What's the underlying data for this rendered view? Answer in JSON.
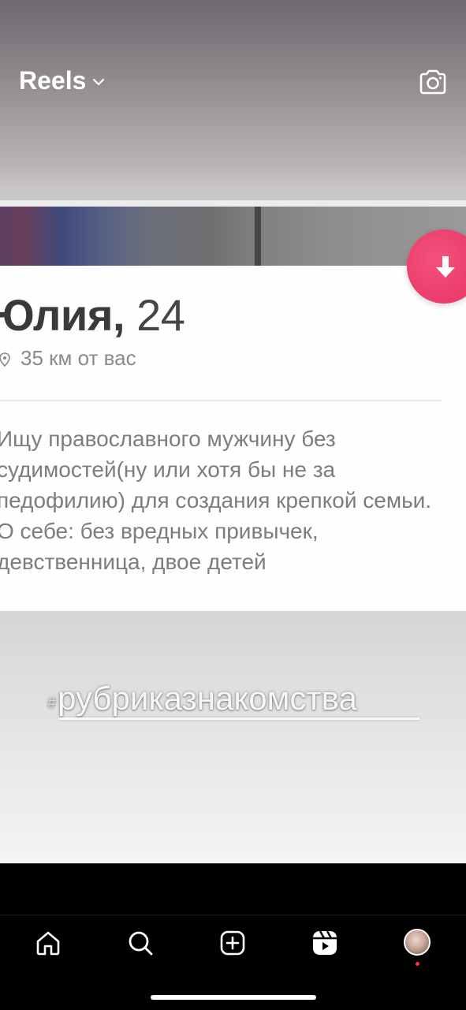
{
  "header": {
    "title": "Reels",
    "dropdown_icon": "chevron-down-icon",
    "camera_icon": "camera-icon"
  },
  "profile": {
    "name": "Юлия,",
    "age": "24",
    "distance": "35 км от вас",
    "bio": "Ищу православного мужчину без судимостей(ну или хотя бы не за педофилию) для создания крепкой семьи. О себе: без вредных привычек, девственница, двое детей"
  },
  "overlay": {
    "hashtag_symbol": "#",
    "hashtag_text": "рубриказнакомства"
  },
  "nav": {
    "items": [
      {
        "name": "home-icon"
      },
      {
        "name": "search-icon"
      },
      {
        "name": "create-icon"
      },
      {
        "name": "reels-icon"
      },
      {
        "name": "profile-avatar"
      }
    ]
  },
  "colors": {
    "accent": "#ee3f6f",
    "notification": "#ff3040"
  }
}
